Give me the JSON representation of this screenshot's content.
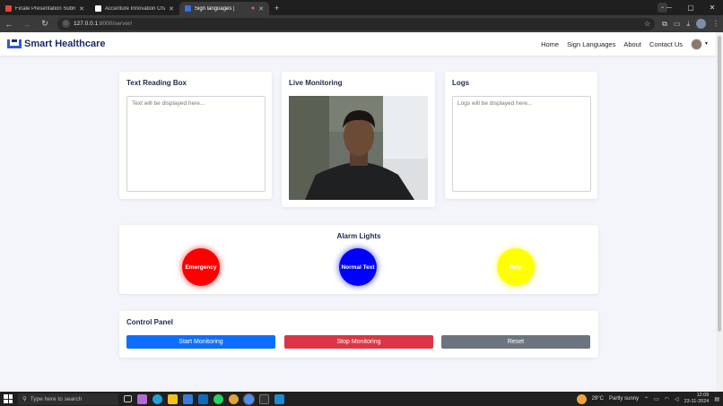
{
  "browser": {
    "tabs": [
      {
        "title": "Finale Presentation Submission",
        "icon_color": "#ea4335",
        "active": false
      },
      {
        "title": "Accenture Innovation Challenge",
        "icon_color": "#ffffff",
        "active": false
      },
      {
        "title": "Sign languages |",
        "icon_color": "#3f6fd8",
        "active": true
      }
    ],
    "new_tab": "+",
    "url_host": "127.0.0.1",
    "url_path": ":8000/server/"
  },
  "navbar": {
    "brand": "Smart Healthcare",
    "links": [
      "Home",
      "Sign Languages",
      "About",
      "Contact Us"
    ]
  },
  "text_reading": {
    "title": "Text Reading Box",
    "placeholder": "Text will be displayed here..."
  },
  "live_monitoring": {
    "title": "Live Monitoring"
  },
  "logs": {
    "title": "Logs",
    "placeholder": "Logs will be displayed here..."
  },
  "alarm": {
    "title": "Alarm Lights",
    "lights": [
      {
        "label": "Emergency",
        "color": "#ff0000"
      },
      {
        "label": "Normal Text",
        "color": "#0000ff"
      },
      {
        "label": "Help",
        "color": "#ffff00"
      }
    ]
  },
  "control": {
    "title": "Control Panel",
    "start": "Start Monitoring",
    "stop": "Stop Monitoring",
    "reset": "Reset",
    "colors": {
      "start": "#0d6efd",
      "stop": "#dc3545",
      "reset": "#6c757d"
    }
  },
  "taskbar": {
    "search_placeholder": "Type here to search",
    "weather": "29°C",
    "weather_desc": "Partly sunny",
    "time": "12:09",
    "date": "23-11-2024"
  }
}
